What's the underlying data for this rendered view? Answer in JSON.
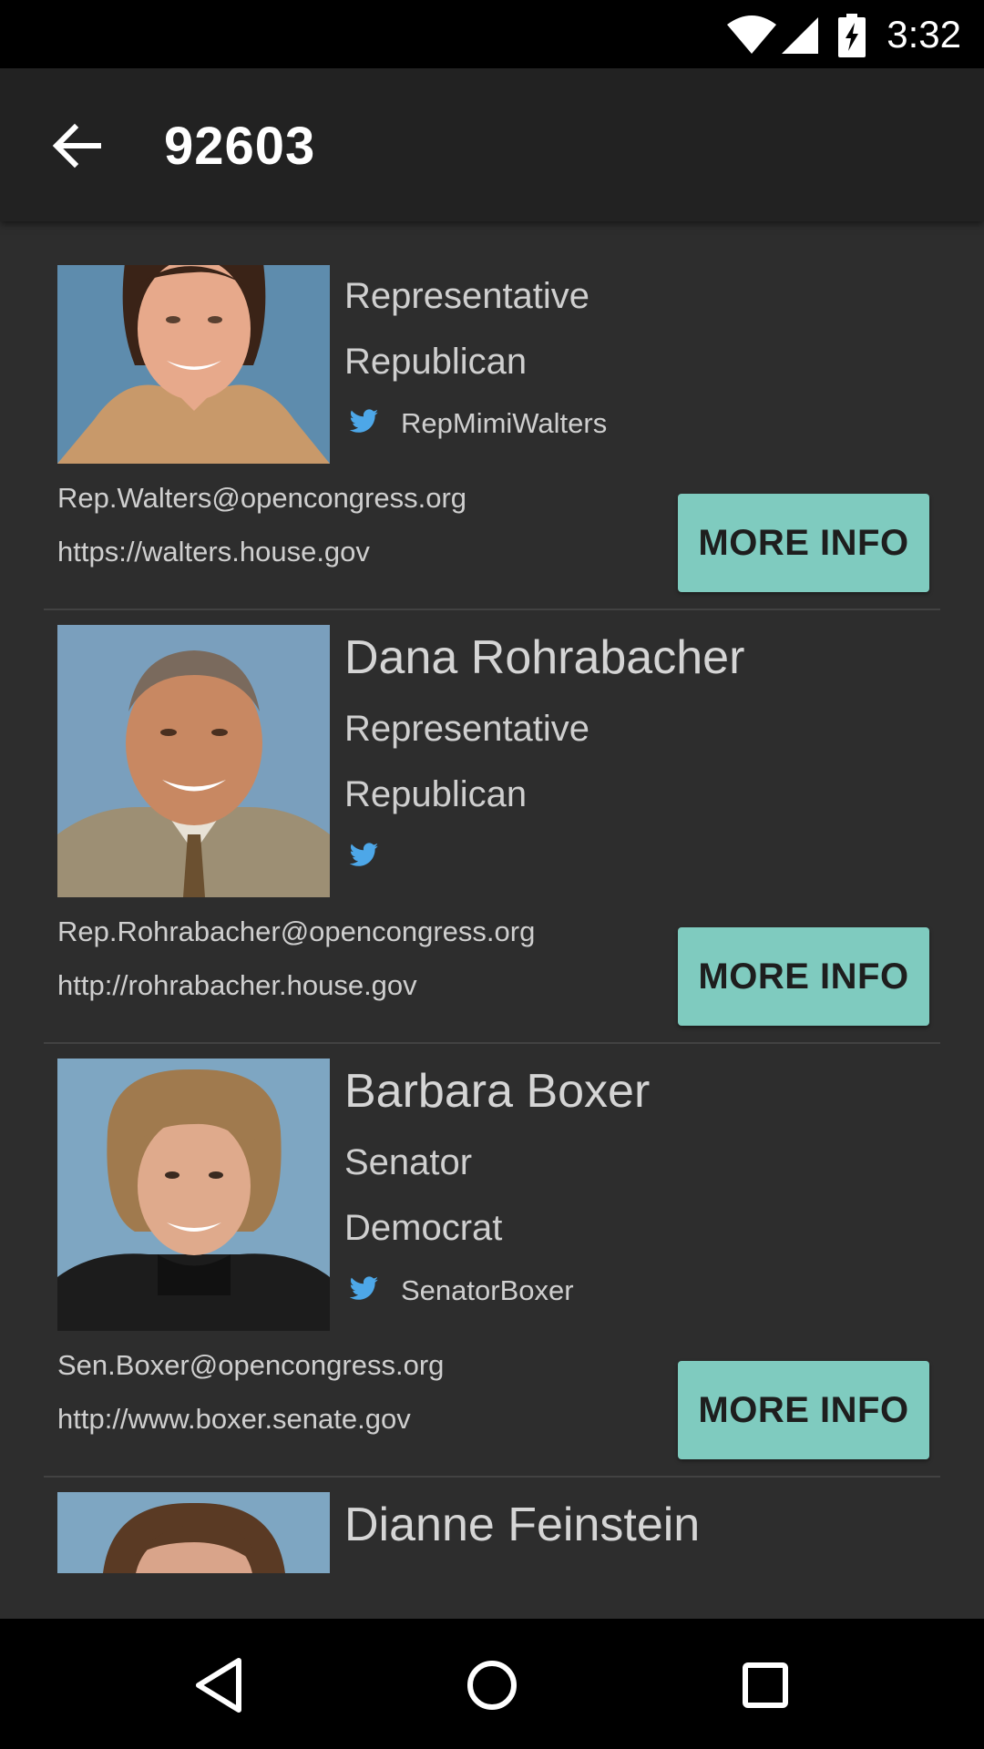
{
  "status_bar": {
    "time": "3:32",
    "icons": [
      "wifi-icon",
      "cell-signal-icon",
      "battery-charging-icon"
    ]
  },
  "app_bar": {
    "back_icon": "arrow-back-icon",
    "title": "92603"
  },
  "colors": {
    "background": "#2d2d2d",
    "app_bar": "#222222",
    "button": "#7fcbbf",
    "twitter_blue": "#4da7e8"
  },
  "legislators": [
    {
      "name": "",
      "role": "Representative",
      "party": "Republican",
      "twitter": "RepMimiWalters",
      "email": "Rep.Walters@opencongress.org",
      "website": "https://walters.house.gov",
      "button_label": "MORE INFO"
    },
    {
      "name": "Dana Rohrabacher",
      "role": "Representative",
      "party": "Republican",
      "twitter": "",
      "email": "Rep.Rohrabacher@opencongress.org",
      "website": "http://rohrabacher.house.gov",
      "button_label": "MORE INFO"
    },
    {
      "name": "Barbara Boxer",
      "role": "Senator",
      "party": "Democrat",
      "twitter": "SenatorBoxer",
      "email": "Sen.Boxer@opencongress.org",
      "website": "http://www.boxer.senate.gov",
      "button_label": "MORE INFO"
    },
    {
      "name": "Dianne Feinstein"
    }
  ],
  "nav_bar": {
    "icons": [
      "back-triangle-icon",
      "home-circle-icon",
      "recents-square-icon"
    ]
  }
}
